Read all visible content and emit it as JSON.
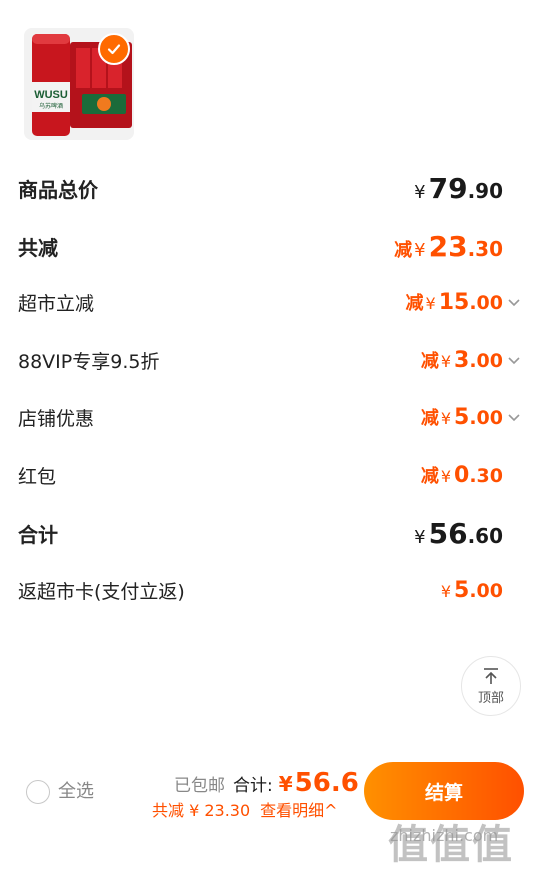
{
  "product": {
    "image_alt": "Wusu beer cans",
    "image_text": "WUSU",
    "selected": true
  },
  "breakdown": {
    "total_label": "商品总价",
    "total_yen": "¥",
    "total_int": "79",
    "total_dec": ".90",
    "discount_label": "共减",
    "discount_minus": "减",
    "discount_yen": "¥",
    "discount_int": "23",
    "discount_dec": ".30",
    "items": [
      {
        "label": "超市立减",
        "minus": "减",
        "yen": "¥",
        "int": "15",
        "dec": ".00",
        "expandable": true
      },
      {
        "label": "88VIP专享9.5折",
        "minus": "减",
        "yen": "¥",
        "int": "3",
        "dec": ".00",
        "expandable": true
      },
      {
        "label": "店铺优惠",
        "minus": "减",
        "yen": "¥",
        "int": "5",
        "dec": ".00",
        "expandable": true
      },
      {
        "label": "红包",
        "minus": "减",
        "yen": "¥",
        "int": "0",
        "dec": ".30",
        "expandable": false
      }
    ],
    "sum_label": "合计",
    "sum_yen": "¥",
    "sum_int": "56",
    "sum_dec": ".60",
    "rebate_label": "返超市卡(支付立返)",
    "rebate_yen": "¥",
    "rebate_int": "5",
    "rebate_dec": ".00"
  },
  "scroll_top": {
    "label": "顶部",
    "icon": "arrow-up-icon"
  },
  "bottom_bar": {
    "select_all_label": "全选",
    "shipped_label": "已包邮",
    "total_label": "合计:",
    "total_yen": "¥",
    "total_value": "56.6",
    "discount_text": "共减 ¥ 23.30",
    "detail_link": "查看明细^",
    "checkout_label": "结算"
  },
  "watermark": {
    "text": "值值值",
    "url": "zhizhizhi.com"
  },
  "colors": {
    "accent": "#ff5000",
    "accent_light": "#ff9000",
    "text": "#1a1a1a",
    "muted": "#888888"
  }
}
